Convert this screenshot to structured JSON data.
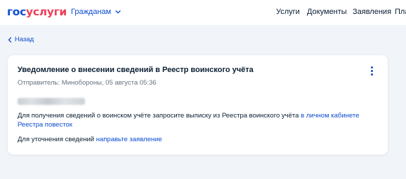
{
  "header": {
    "logo_part1": "гос",
    "logo_part2": "услуги",
    "audience": "Гражданам",
    "nav": [
      "Услуги",
      "Документы",
      "Заявления",
      "Пла"
    ]
  },
  "back_link": "Назад",
  "notice": {
    "title": "Уведомление о внесении сведений в Реестр воинского учёта",
    "meta": "Отправитель: Минобороны, 05 августа 05:36",
    "paragraph1_text": "Для получения сведений о воинском учёте запросите выписку из Реестра воинского учёта ",
    "paragraph1_link": "в личном кабинете Реестра повесток",
    "paragraph2_text": "Для уточнения сведений ",
    "paragraph2_link": "направьте заявление"
  },
  "colors": {
    "brand_blue": "#0d4cd3",
    "brand_red": "#ee3f58",
    "text": "#0b1f33",
    "muted": "#66727f",
    "background": "#f1f4f8"
  },
  "icons": [
    "chevron-down-icon",
    "chevron-left-icon",
    "kebab-menu-icon"
  ]
}
